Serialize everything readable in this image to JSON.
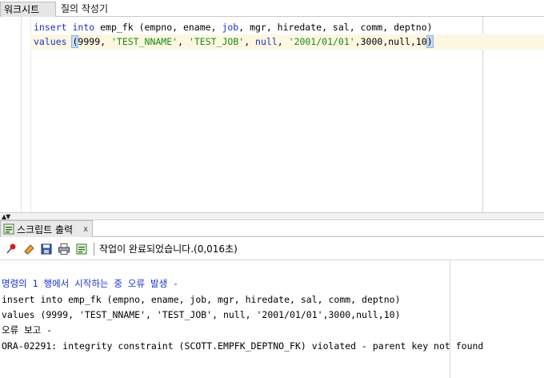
{
  "worksheet_tabs": [
    "워크시트",
    "질의 작성기"
  ],
  "editor": {
    "line1": {
      "kw_insert": "insert",
      "sp1": " ",
      "kw_into": "into",
      "rest_a": " emp_fk (empno, ename, ",
      "kw_job": "job",
      "rest_b": ", mgr, hiredate, sal, comm, deptno)"
    },
    "line2": {
      "kw_values": "values",
      "sp": " ",
      "paren_open": "(",
      "n1": "9999",
      "c1": ", ",
      "s1": "'TEST_NNAME'",
      "c2": ", ",
      "s2": "'TEST_JOB'",
      "c3": ", ",
      "kw_null": "null",
      "c4": ", ",
      "s3": "'2001/01/01'",
      "rest": ",3000,null,10",
      "paren_close": ")"
    }
  },
  "output_panel": {
    "tab_label": "스크립트 출력",
    "close_label": "x",
    "status_text": "작업이 완료되었습니다.(0,016초)",
    "lines": [
      "명령의 1 행에서 시작하는 중 오류 발생 -",
      "insert into emp_fk (empno, ename, job, mgr, hiredate, sal, comm, deptno)",
      "values (9999, 'TEST_NNAME', 'TEST_JOB', null, '2001/01/01',3000,null,10)",
      "오류 보고 -",
      "ORA-02291: integrity constraint (SCOTT.EMPFK_DEPTNO_FK) violated - parent key not found"
    ]
  },
  "icons": {
    "toolbar": [
      "pin-icon",
      "eraser-icon",
      "save-icon",
      "print-icon",
      "export-icon"
    ],
    "tab": "script-output-icon"
  },
  "colors": {
    "keyword": "#1a32c8",
    "string": "#1a8a1a",
    "current_line": "#fdf7e2"
  }
}
